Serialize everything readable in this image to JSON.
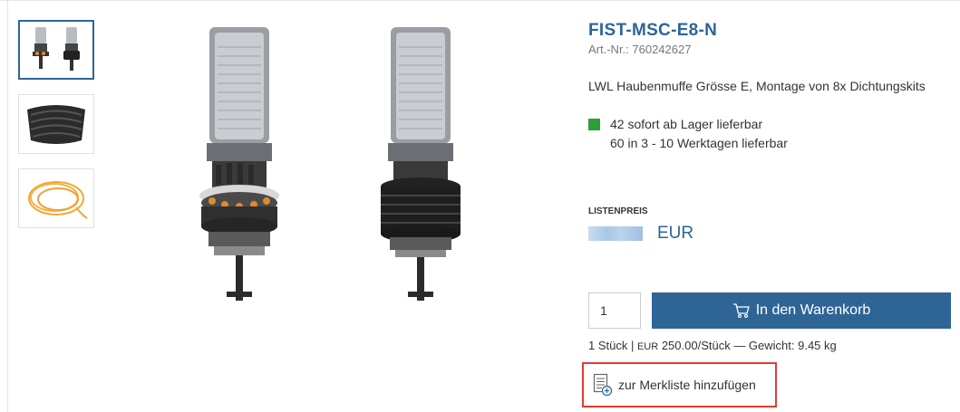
{
  "product": {
    "title": "FIST-MSC-E8-N",
    "article_number": "Art.-Nr.: 760242627",
    "description": "LWL Haubenmuffe Grösse E, Montage von 8x Dichtungskits"
  },
  "stock": {
    "available_now": "42 sofort ab Lager lieferbar",
    "available_later": "60 in 3 - 10 Werktagen lieferbar",
    "indicator_color": "#2e9e3a"
  },
  "price": {
    "label": "LISTENPREIS",
    "currency": "EUR"
  },
  "cart": {
    "quantity": "1",
    "button_label": "In den Warenkorb"
  },
  "unit_info": {
    "prefix": "1 Stück | ",
    "currency_small": "EUR",
    "suffix": " 250.00/Stück — Gewicht: 9.45 kg"
  },
  "wishlist": {
    "label": "zur Merkliste hinzufügen"
  },
  "thumbnails": [
    {
      "name": "product-pair"
    },
    {
      "name": "seal-kit"
    },
    {
      "name": "orange-cable"
    }
  ],
  "colors": {
    "accent": "#2e6596",
    "highlight": "#e53935"
  }
}
